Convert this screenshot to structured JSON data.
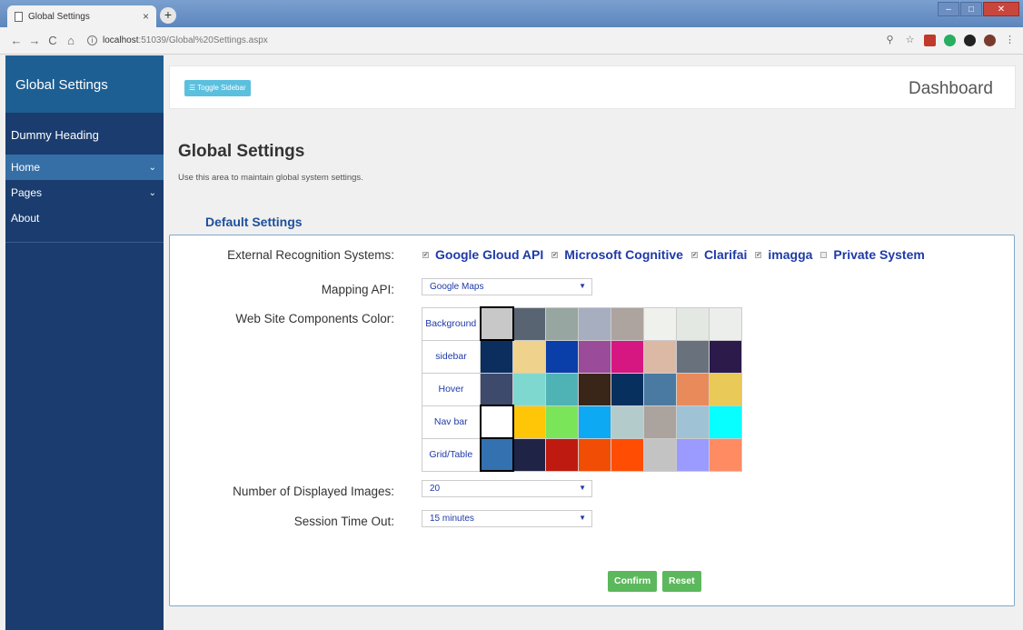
{
  "browser": {
    "tab_title": "Global Settings",
    "tab_close": "×",
    "new_tab": "+",
    "url_host": "localhost",
    "url_rest": ":51039/Global%20Settings.aspx",
    "win_min": "–",
    "win_max": "□",
    "win_close": "✕"
  },
  "sidebar": {
    "header": "Global Settings",
    "subheading": "Dummy Heading",
    "items": [
      {
        "label": "Home",
        "has_chevron": true,
        "active": true
      },
      {
        "label": "Pages",
        "has_chevron": true,
        "active": false
      },
      {
        "label": "About",
        "has_chevron": false,
        "active": false
      }
    ]
  },
  "topbar": {
    "toggle_label": "Toggle Sidebar",
    "title": "Dashboard"
  },
  "page": {
    "title": "Global Settings",
    "subtitle": "Use this area to maintain global system settings.",
    "section_title": "Default Settings"
  },
  "form": {
    "recognition_label": "External Recognition Systems:",
    "recognition_options": [
      {
        "label": "Google Gloud API",
        "checked": true
      },
      {
        "label": "Microsoft Cognitive",
        "checked": true
      },
      {
        "label": "Clarifai",
        "checked": true
      },
      {
        "label": "imagga",
        "checked": true
      },
      {
        "label": "Private System",
        "checked": false
      }
    ],
    "mapping_label": "Mapping API:",
    "mapping_value": "Google Maps",
    "colors_label": "Web Site Components Color:",
    "color_rows": [
      {
        "label": "Background",
        "swatches": [
          "#c8c8c8",
          "#596473",
          "#97a6a0",
          "#a7aec0",
          "#ada49f",
          "#eef1ec",
          "#e4e8e3",
          "#ebeeea"
        ],
        "selected": 0
      },
      {
        "label": "sidebar",
        "swatches": [
          "#0b2e5e",
          "#efd38c",
          "#0a3ea8",
          "#9a4c9a",
          "#d61781",
          "#dcb9a5",
          "#69727c",
          "#2c1a4a"
        ],
        "selected": -1
      },
      {
        "label": "Hover",
        "swatches": [
          "#3e4a6b",
          "#7fd8d0",
          "#4fb3b6",
          "#3a2618",
          "#07305f",
          "#4a7aa1",
          "#e98a5b",
          "#e9c957"
        ],
        "selected": -1
      },
      {
        "label": "Nav bar",
        "swatches": [
          "#ffffff",
          "#fec606",
          "#7be55a",
          "#0ea9f3",
          "#b3cccb",
          "#aba39d",
          "#9fc2d5",
          "#07ffff"
        ],
        "selected": 0
      },
      {
        "label": "Grid/Table",
        "swatches": [
          "#3471b0",
          "#1f2446",
          "#be1a0f",
          "#f24d05",
          "#ff4d04",
          "#c3c3c3",
          "#9a9aff",
          "#ff8b63"
        ],
        "selected": 0
      }
    ],
    "images_label": "Number of Displayed Images:",
    "images_value": "20",
    "timeout_label": "Session Time Out:",
    "timeout_value": "15 minutes",
    "confirm_label": "Confirm",
    "reset_label": "Reset"
  },
  "icons": {
    "back": "←",
    "forward": "→",
    "reload": "C",
    "home": "⌂",
    "zoom": "🔍",
    "star": "☆",
    "menu": "⋮",
    "caret": "▼",
    "chevron": "⌄",
    "check": "✔"
  }
}
